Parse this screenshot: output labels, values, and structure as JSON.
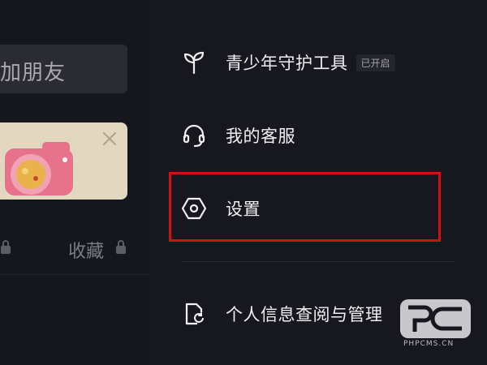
{
  "left_panel": {
    "add_friend_label": "加朋友",
    "favorites_label": "收藏"
  },
  "menu": {
    "items": [
      {
        "label": "青少年守护工具",
        "badge": "已开启",
        "icon": "sprout-icon"
      },
      {
        "label": "我的客服",
        "icon": "headset-icon"
      },
      {
        "label": "设置",
        "icon": "settings-hexagon-icon"
      },
      {
        "label": "个人信息查阅与管理",
        "icon": "document-refresh-icon"
      }
    ]
  },
  "watermark": {
    "text": "PHPCMS.CN"
  },
  "colors": {
    "background": "#17181f",
    "highlight": "#d20f12",
    "text": "#f1f1f3"
  }
}
